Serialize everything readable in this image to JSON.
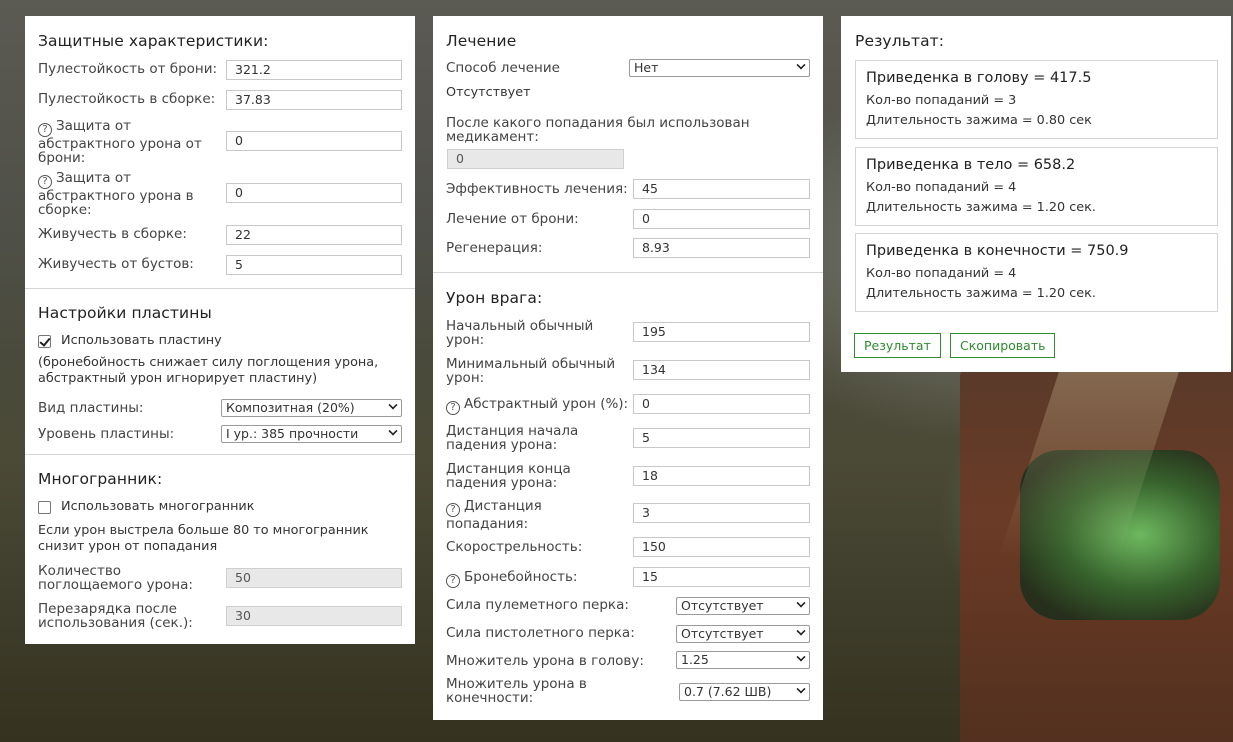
{
  "defense": {
    "title": "Защитные характеристики:",
    "rows": [
      {
        "label": "Пулестойкость от брони:",
        "value": "321.2"
      },
      {
        "label": "Пулестойкость в сборке:",
        "value": "37.83"
      },
      {
        "label": "Защита от абстрактного урона от брони:",
        "value": "0"
      },
      {
        "label": "Защита от абстрактного урона в сборке:",
        "value": "0"
      },
      {
        "label": "Живучесть в сборке:",
        "value": "22"
      },
      {
        "label": "Живучесть от бустов:",
        "value": "5"
      }
    ]
  },
  "plate": {
    "title": "Настройки пластины",
    "use_label": "Использовать пластину",
    "use_checked": true,
    "note": "(бронебойность снижает силу поглощения урона, абстрактный урон игнорирует пластину)",
    "type_label": "Вид пластины:",
    "type_value": "Композитная (20%)",
    "level_label": "Уровень пластины:",
    "level_value": "I ур.: 385 прочности"
  },
  "poly": {
    "title": "Многогранник:",
    "use_label": "Использовать многогранник",
    "use_checked": false,
    "note": "Если урон выстрела больше 80 то многогранник снизит урон от попадания",
    "absorb_label": "Количество поглощаемого урона:",
    "absorb_value": "50",
    "reload_label": "Перезарядка после использования (сек.):",
    "reload_value": "30"
  },
  "heal": {
    "title": "Лечение",
    "method_label": "Способ лечение",
    "method_value": "Нет",
    "method_desc": "Отсутствует",
    "after_hit_label": "После какого попадания был использован медикамент:",
    "after_hit_value": "0",
    "efficiency_label": "Эффективность лечения:",
    "efficiency_value": "45",
    "armor_heal_label": "Лечение от брони:",
    "armor_heal_value": "0",
    "regen_label": "Регенерация:",
    "regen_value": "8.93"
  },
  "enemy": {
    "title": "Урон врага:",
    "rows": [
      {
        "label": "Начальный обычный урон:",
        "value": "195"
      },
      {
        "label": "Минимальный обычный урон:",
        "value": "134"
      },
      {
        "label": "Абстрактный урон (%):",
        "value": "0"
      },
      {
        "label": "Дистанция начала падения урона:",
        "value": "5"
      },
      {
        "label": "Дистанция конца падения урона:",
        "value": "18"
      },
      {
        "label": "Дистанция попадания:",
        "value": "3"
      },
      {
        "label": "Скорострельность:",
        "value": "150"
      },
      {
        "label": "Бронебойность:",
        "value": "15"
      }
    ],
    "selects": [
      {
        "label": "Сила пулеметного перка:",
        "value": "Отсутствует"
      },
      {
        "label": "Сила пистолетного перка:",
        "value": "Отсутствует"
      },
      {
        "label": "Множитель урона в голову:",
        "value": "1.25"
      },
      {
        "label": "Множитель урона в конечности:",
        "value": "0.7 (7.62 ШВ)"
      }
    ]
  },
  "result": {
    "title": "Результат:",
    "boxes": [
      {
        "title": "Приведенка в голову = 417.5",
        "hits": "Кол-во попаданий = 3",
        "duration": "Длительность зажима = 0.80 сек"
      },
      {
        "title": "Приведенка в тело = 658.2",
        "hits": "Кол-во попаданий = 4",
        "duration": "Длительность зажима = 1.20 сек."
      },
      {
        "title": "Приведенка в конечности = 750.9",
        "hits": "Кол-во попаданий = 4",
        "duration": "Длительность зажима = 1.20 сек."
      }
    ],
    "result_button": "Результат",
    "copy_button": "Скопировать"
  }
}
